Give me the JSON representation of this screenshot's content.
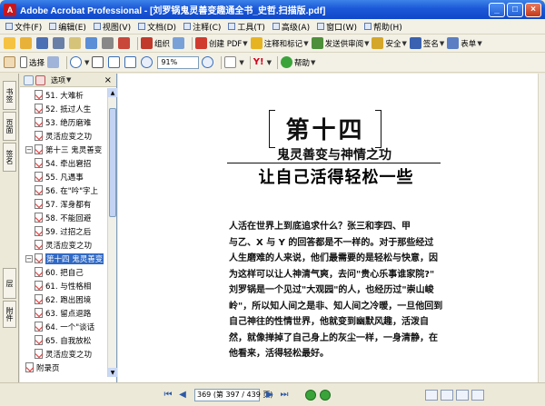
{
  "window": {
    "title": "Adobe Acrobat Professional - [刘罗锅鬼灵善变趣通全书_史哲.扫描版.pdf]",
    "app_icon_label": "A",
    "minimize": "_",
    "maximize": "□",
    "close": "×"
  },
  "menu": {
    "items": [
      "文件(F)",
      "编辑(E)",
      "视图(V)",
      "文档(D)",
      "注释(C)",
      "工具(T)",
      "高级(A)",
      "窗口(W)",
      "帮助(H)"
    ]
  },
  "toolbar1": {
    "items": [
      {
        "label": "",
        "icon": "new-icon",
        "color": "#f5c242"
      },
      {
        "label": "",
        "icon": "open-icon",
        "color": "#e8b13a"
      },
      {
        "label": "",
        "icon": "save-icon",
        "color": "#4b6fb5"
      },
      {
        "label": "",
        "icon": "print-icon",
        "color": "#6a7fa6"
      },
      {
        "label": "",
        "icon": "email-icon",
        "color": "#d6c37a"
      },
      {
        "label": "",
        "icon": "search-icon",
        "color": "#5a8ed6"
      },
      {
        "label": "",
        "icon": "attach-icon",
        "color": "#888888"
      },
      {
        "label": "",
        "icon": "sign-icon",
        "color": "#c9463a"
      },
      {
        "label": "组织",
        "icon": "organize-icon",
        "color": "#c0392b"
      },
      {
        "label": "",
        "icon": "export-icon",
        "color": "#7aa0d8"
      },
      {
        "label": "创建 PDF",
        "icon": "create-pdf-icon",
        "color": "#d03b2f"
      },
      {
        "label": "注释和标记",
        "icon": "comment-icon",
        "color": "#e6b422"
      },
      {
        "label": "发送供审阅",
        "icon": "review-icon",
        "color": "#4d8f3a"
      },
      {
        "label": "安全",
        "icon": "lock-icon",
        "color": "#d4a62a"
      },
      {
        "label": "签名",
        "icon": "pen-icon",
        "color": "#3a62b0"
      },
      {
        "label": "表单",
        "icon": "form-icon",
        "color": "#5b7fc2"
      }
    ]
  },
  "toolbar2": {
    "select_label": "选择",
    "zoom_value": "91%",
    "help_label": "帮助",
    "yahoo_label": "Y!"
  },
  "left_tabs": [
    "书签",
    "页面",
    "签名",
    "层",
    "附件"
  ],
  "bookmarks_panel": {
    "options_label": "选项",
    "close": "×",
    "items": [
      {
        "text": "51. 大难析",
        "level": 2,
        "selected": false
      },
      {
        "text": "52. 抵过人生",
        "level": 2,
        "selected": false
      },
      {
        "text": "53. 绝历磨难",
        "level": 2,
        "selected": false
      },
      {
        "text": "灵活应变之功",
        "level": 2,
        "selected": false
      },
      {
        "text": "第十三 鬼灵善变",
        "level": 1,
        "selected": false
      },
      {
        "text": "54. 牵出窘招",
        "level": 2,
        "selected": false
      },
      {
        "text": "55. 凡遇事",
        "level": 2,
        "selected": false
      },
      {
        "text": "56. 在\"吟\"字上",
        "level": 2,
        "selected": false
      },
      {
        "text": "57. 浑身都有",
        "level": 2,
        "selected": false
      },
      {
        "text": "58. 不能回避",
        "level": 2,
        "selected": false
      },
      {
        "text": "59. 过招之后",
        "level": 2,
        "selected": false
      },
      {
        "text": "灵活应变之功",
        "level": 2,
        "selected": false
      },
      {
        "text": "第十四 鬼灵善变",
        "level": 1,
        "selected": true
      },
      {
        "text": "60. 把自己",
        "level": 2,
        "selected": false
      },
      {
        "text": "61. 与性格相",
        "level": 2,
        "selected": false
      },
      {
        "text": "62. 跑出困境",
        "level": 2,
        "selected": false
      },
      {
        "text": "63. 留点退路",
        "level": 2,
        "selected": false
      },
      {
        "text": "64. 一个\"谈话",
        "level": 2,
        "selected": false
      },
      {
        "text": "65. 自我放松",
        "level": 2,
        "selected": false
      },
      {
        "text": "灵活应变之功",
        "level": 2,
        "selected": false
      },
      {
        "text": "附录页",
        "level": 1,
        "selected": false
      }
    ]
  },
  "document": {
    "chapter": "第十四",
    "subtitle": "鬼灵善变与神情之功",
    "headline": "让自己活得轻松一些",
    "body_lines": [
      "人活在世界上到底追求什么？张三和李四、甲",
      "与乙、X 与 Y 的回答都是不一样的。对于那些经过",
      "人生磨难的人来说，他们最需要的是轻松与快意，因",
      "为这样可以让人神清气爽，去问\"贵心乐事谁家院?\"",
      "刘罗锅是一个见过\"大观园\"的人，也经历过\"崇山峻",
      "岭\"，所以知人间之是非、知人间之冷暖，一旦他回到",
      "自己神往的性情世界，他就变到幽默风趣，活泼自",
      "然，就像掸掉了自己身上的灰尘一样，一身清静，在",
      "他看来，活得轻松最好。"
    ]
  },
  "statusbar": {
    "page_field": "369 (第 397 / 439 页)"
  }
}
